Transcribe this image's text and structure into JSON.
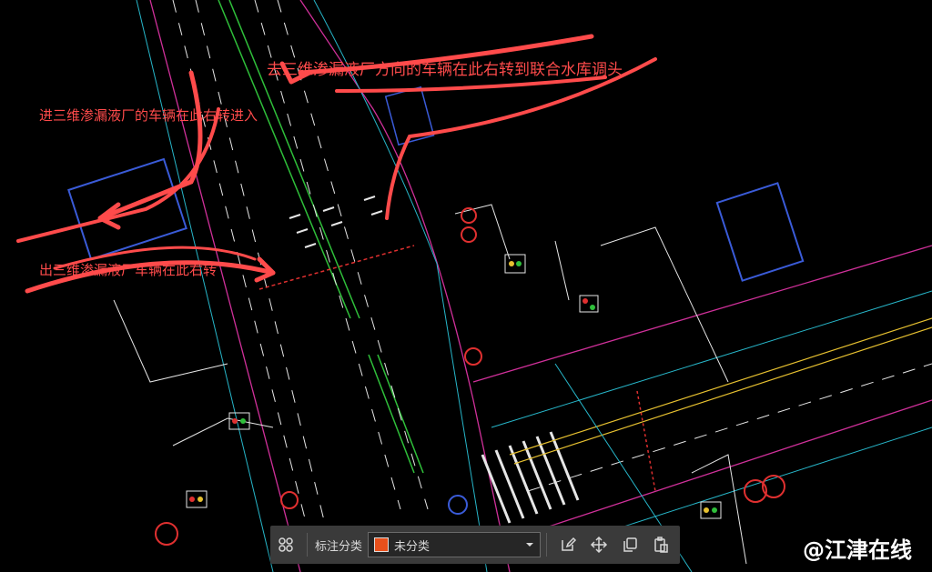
{
  "annotations": {
    "top_text": "去三维渗漏液厂方向的车辆在此右转到联合水库调头",
    "left_text": "进三维渗漏液厂的车辆在此右转进入",
    "bottom_text": "出三维渗漏液厂车辆在此右转"
  },
  "toolbar": {
    "category_label": "标注分类",
    "category_value": "未分类",
    "swatch_color": "#e8501c",
    "icons": [
      "layout-grid-icon",
      "edit-icon",
      "move-icon",
      "copy-icon",
      "paste-icon"
    ]
  },
  "watermark": "@江津在线",
  "colors": {
    "annotation_red": "#ff4b4b",
    "road_magenta": "#d0309a",
    "road_cyan": "#27b6c9",
    "lane_white": "#e6e6e6",
    "median_green": "#2fbf3a",
    "sign_blue": "#3a5bd8",
    "signal_red": "#e03030"
  }
}
